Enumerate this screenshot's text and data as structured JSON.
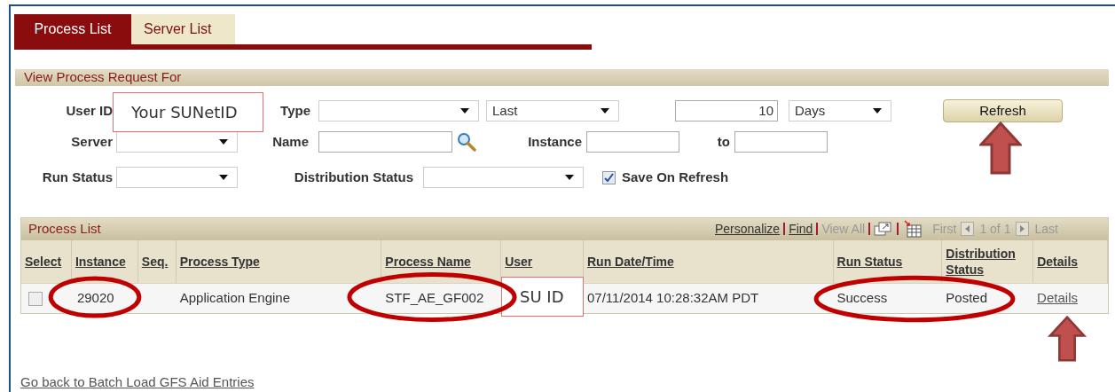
{
  "tabs": [
    {
      "label": "Process List",
      "selected": true
    },
    {
      "label": "Server List",
      "selected": false
    }
  ],
  "filter": {
    "title": "View Process Request For",
    "user_id_label": "User ID",
    "type_label": "Type",
    "range_select": "Last",
    "range_value": "10",
    "range_unit": "Days",
    "refresh_button": "Refresh",
    "server_label": "Server",
    "name_label": "Name",
    "instance_label": "Instance",
    "to_label": "to",
    "run_status_label": "Run Status",
    "distribution_status_label": "Distribution Status",
    "save_on_refresh": {
      "label": "Save On Refresh",
      "checked": true
    }
  },
  "process_list": {
    "title": "Process List",
    "toolbar": {
      "personalize": "Personalize",
      "find": "Find",
      "view_all": "View All",
      "first": "First",
      "page": "1 of 1",
      "last": "Last"
    },
    "columns": [
      "Select",
      "Instance",
      "Seq.",
      "Process Type",
      "Process Name",
      "User",
      "Run Date/Time",
      "Run Status",
      "Distribution Status",
      "Details"
    ],
    "rows": [
      {
        "selected": false,
        "instance": "29020",
        "process_type": "Application Engine",
        "process_name": "STF_AE_GF002",
        "run_date": "07/11/2014 10:28:32AM PDT",
        "run_status": "Success",
        "distribution_status": "Posted",
        "details": "Details"
      }
    ]
  },
  "back_link": "Go back to Batch Load GFS Aid Entries",
  "callouts": [
    {
      "text": "Your SUNetID"
    },
    {
      "text": "SU ID"
    }
  ]
}
